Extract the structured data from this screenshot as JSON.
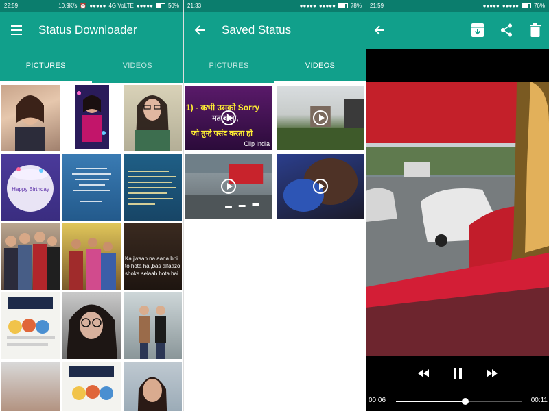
{
  "downloader": {
    "status": {
      "time": "22:59",
      "speed": "10.9K/s",
      "network": "4G VoLTE",
      "battery": "50%",
      "battery_level": 0.5
    },
    "title": "Status Downloader",
    "tabs": [
      {
        "label": "PICTURES",
        "active": true
      },
      {
        "label": "VIDEOS",
        "active": false
      }
    ],
    "thumb_captions": {
      "cake": "Happy Birthday",
      "quote1": "Ka jwaab na aana bhi to hota hai,bas alfaazo shoka selaab hota hai"
    }
  },
  "saved": {
    "status": {
      "time": "21:33",
      "battery": "78%",
      "battery_level": 0.78
    },
    "title": "Saved Status",
    "tabs": [
      {
        "label": "PICTURES",
        "active": false
      },
      {
        "label": "VIDEOS",
        "active": true
      }
    ],
    "video1_caption": {
      "line1": "1) - कभी उसको Sorry",
      "line2": "मत बोलो,",
      "line3": "जो तुम्हे पसंद करता हो",
      "watermark": "Clip India"
    }
  },
  "player": {
    "status": {
      "time": "21:59",
      "battery": "76%",
      "battery_level": 0.76
    },
    "elapsed": "00:06",
    "duration": "00:11",
    "progress": 0.55
  },
  "colors": {
    "primary": "#11a08b",
    "primary_dark": "#0b7d6d",
    "accent": "#ffffff"
  },
  "icons": {
    "menu": "hamburger-menu-icon",
    "back": "arrow-back-icon",
    "save": "archive-download-icon",
    "share": "share-icon",
    "delete": "trash-icon",
    "play": "play-icon",
    "rewind": "rewind-icon",
    "pause": "pause-icon",
    "forward": "fast-forward-icon"
  }
}
